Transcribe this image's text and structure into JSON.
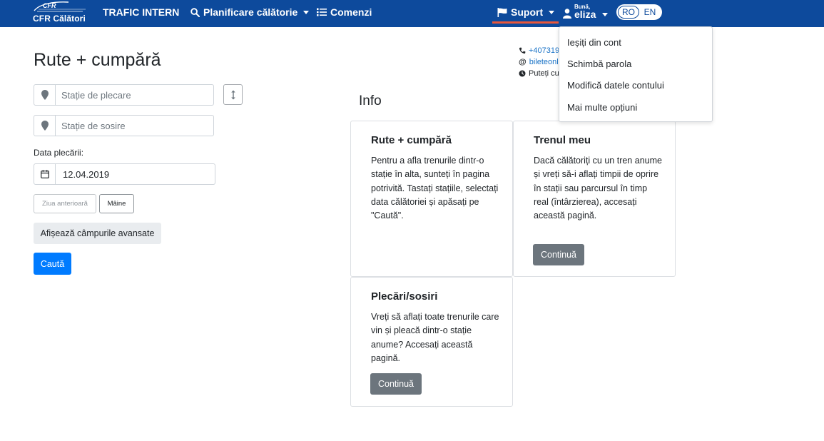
{
  "navbar": {
    "logo_top_text": "CFR",
    "logo_text": "CFR Călători",
    "trafic_label": "TRAFIC INTERN",
    "planificare_label": "Planificare călătorie",
    "comenzi_label": "Comenzi",
    "suport_label": "Suport",
    "greeting": "Bună,",
    "username": "eliza",
    "lang_ro": "RO",
    "lang_en": "EN",
    "bar_color": "#0d4a9c",
    "accent_color": "#e8573b"
  },
  "user_menu": {
    "items": [
      "Ieșiți din cont",
      "Schimbă parola",
      "Modifică datele contului",
      "Mai multe opțiuni"
    ]
  },
  "contact": {
    "phone": "+407319",
    "email": "bileteonl",
    "hours": "Puteți cu"
  },
  "form": {
    "title": "Rute + cumpără",
    "departure_placeholder": "Stație de plecare",
    "arrival_placeholder": "Stație de sosire",
    "date_label": "Data plecării:",
    "date_value": "12.04.2019",
    "prev_day": "Ziua anterioară",
    "next_day": "Mâine",
    "advanced_label": "Afișează câmpurile avansate",
    "search_label": "Caută",
    "search_color": "#007bff"
  },
  "info": {
    "title": "Info",
    "cards": [
      {
        "title": "Rute + cumpără",
        "text": "Pentru a afla trenurile dintr-o stație în alta, sunteți în pagina potrivită. Tastați stațiile, selectați data călătoriei și apăsați pe \"Caută\"."
      },
      {
        "title": "Trenul meu",
        "text": "Dacă călătoriți cu un tren anume și vreți să-i aflați timpii de oprire în stații sau parcursul în timp real (întârzierea), accesați această pagină.",
        "button": "Continuă"
      },
      {
        "title": "Plecări/sosiri",
        "text": "Vreți să aflați toate trenurile care vin și pleacă dintr-o stație anume? Accesați această pagină.",
        "button": "Continuă"
      }
    ]
  },
  "icons": [
    "cfr-logo-icon",
    "search-icon",
    "list-icon",
    "flag-icon",
    "user-icon",
    "phone-icon",
    "at-icon",
    "clock-icon",
    "map-marker-icon",
    "swap-vertical-icon",
    "calendar-icon"
  ]
}
